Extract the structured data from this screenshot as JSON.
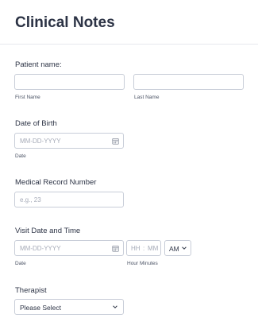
{
  "title": "Clinical Notes",
  "patient": {
    "label": "Patient name:",
    "first_sublabel": "First Name",
    "last_sublabel": "Last Name",
    "first_value": "",
    "last_value": ""
  },
  "dob": {
    "label": "Date of Birth",
    "placeholder": "MM-DD-YYYY",
    "sublabel": "Date"
  },
  "mrn": {
    "label": "Medical Record Number",
    "placeholder": "e.g., 23"
  },
  "visit": {
    "label": "Visit Date and Time",
    "date_placeholder": "MM-DD-YYYY",
    "date_sublabel": "Date",
    "time_placeholder_h": "HH",
    "time_sep": ":",
    "time_placeholder_m": "MM",
    "ampm": "AM",
    "time_sublabel_hour": "Hour",
    "time_sublabel_min": "Minutes"
  },
  "therapist": {
    "label": "Therapist",
    "selected": "Please Select"
  },
  "icons": {
    "calendar": "calendar-icon",
    "chevron": "chevron-down-icon"
  }
}
